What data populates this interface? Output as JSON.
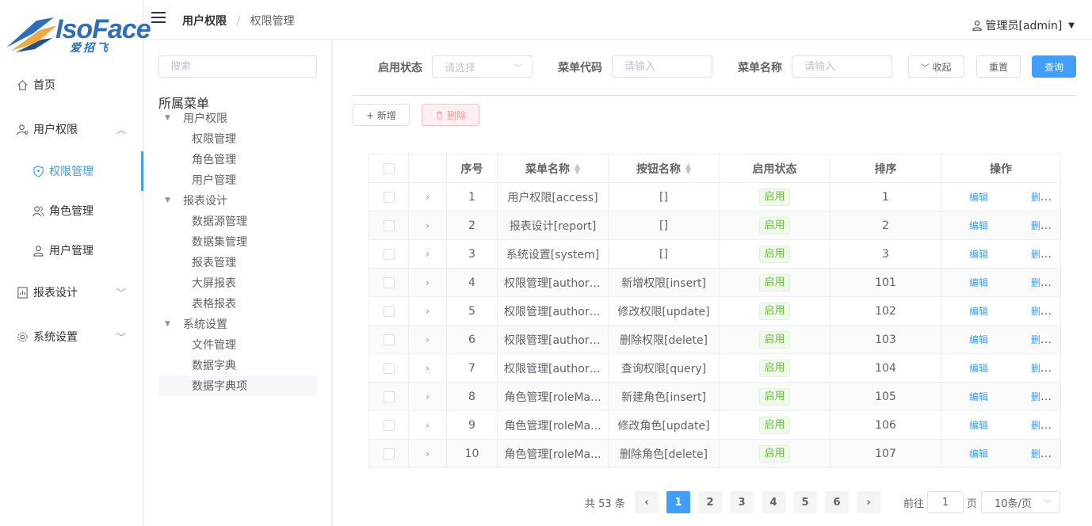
{
  "logo": {
    "text": "IsoFace",
    "sub": "爱招飞"
  },
  "sidebar": {
    "items": [
      {
        "label": "首页",
        "icon": "home-icon"
      },
      {
        "label": "用户权限",
        "icon": "user-group-icon",
        "expanded": true
      },
      {
        "label": "权限管理",
        "icon": "shield-icon",
        "active": true
      },
      {
        "label": "角色管理",
        "icon": "users-icon"
      },
      {
        "label": "用户管理",
        "icon": "user-icon"
      },
      {
        "label": "报表设计",
        "icon": "report-icon"
      },
      {
        "label": "系统设置",
        "icon": "gear-icon"
      }
    ]
  },
  "header": {
    "breadcrumb": [
      "用户权限",
      "权限管理"
    ],
    "user": "管理员[admin]"
  },
  "tree": {
    "search_placeholder": "搜索",
    "title": "所属菜单",
    "groups": [
      {
        "label": "用户权限",
        "children": [
          "权限管理",
          "角色管理",
          "用户管理"
        ]
      },
      {
        "label": "报表设计",
        "children": [
          "数据源管理",
          "数据集管理",
          "报表管理",
          "大屏报表",
          "表格报表"
        ]
      },
      {
        "label": "系统设置",
        "children": [
          "文件管理",
          "数据字典",
          "数据字典项"
        ]
      }
    ]
  },
  "filters": {
    "status_label": "启用状态",
    "status_placeholder": "请选择",
    "code_label": "菜单代码",
    "code_placeholder": "请输入",
    "name_label": "菜单名称",
    "name_placeholder": "请输入",
    "collapse_label": "收起",
    "reset_label": "重置",
    "query_label": "查询"
  },
  "toolbar": {
    "add_label": "+ 新增",
    "delete_label": "删除"
  },
  "table": {
    "headers": [
      "序号",
      "菜单名称",
      "按钮名称",
      "启用状态",
      "排序",
      "操作"
    ],
    "edit_label": "编辑",
    "remove_label": "删除",
    "rows": [
      {
        "no": "1",
        "menu": "用户权限[access]",
        "button": "[]",
        "status": "启用",
        "sort": "1"
      },
      {
        "no": "2",
        "menu": "报表设计[report]",
        "button": "[]",
        "status": "启用",
        "sort": "2"
      },
      {
        "no": "3",
        "menu": "系统设置[system]",
        "button": "[]",
        "status": "启用",
        "sort": "3"
      },
      {
        "no": "4",
        "menu": "权限管理[authori...",
        "button": "新增权限[insert]",
        "status": "启用",
        "sort": "101"
      },
      {
        "no": "5",
        "menu": "权限管理[authori...",
        "button": "修改权限[update]",
        "status": "启用",
        "sort": "102"
      },
      {
        "no": "6",
        "menu": "权限管理[authori...",
        "button": "删除权限[delete]",
        "status": "启用",
        "sort": "103"
      },
      {
        "no": "7",
        "menu": "权限管理[authori...",
        "button": "查询权限[query]",
        "status": "启用",
        "sort": "104"
      },
      {
        "no": "8",
        "menu": "角色管理[roleMa...",
        "button": "新建角色[insert]",
        "status": "启用",
        "sort": "105"
      },
      {
        "no": "9",
        "menu": "角色管理[roleMa...",
        "button": "修改角色[update]",
        "status": "启用",
        "sort": "106"
      },
      {
        "no": "10",
        "menu": "角色管理[roleMa...",
        "button": "删除角色[delete]",
        "status": "启用",
        "sort": "107"
      }
    ]
  },
  "pagination": {
    "total": "共 53 条",
    "pages": [
      "1",
      "2",
      "3",
      "4",
      "5",
      "6"
    ],
    "current": "1",
    "goto_label": "前往",
    "goto_value": "1",
    "page_word": "页",
    "page_size": "10条/页"
  },
  "colors": {
    "primary": "#409eff",
    "success": "#67c23a",
    "danger": "#f56c6c"
  }
}
